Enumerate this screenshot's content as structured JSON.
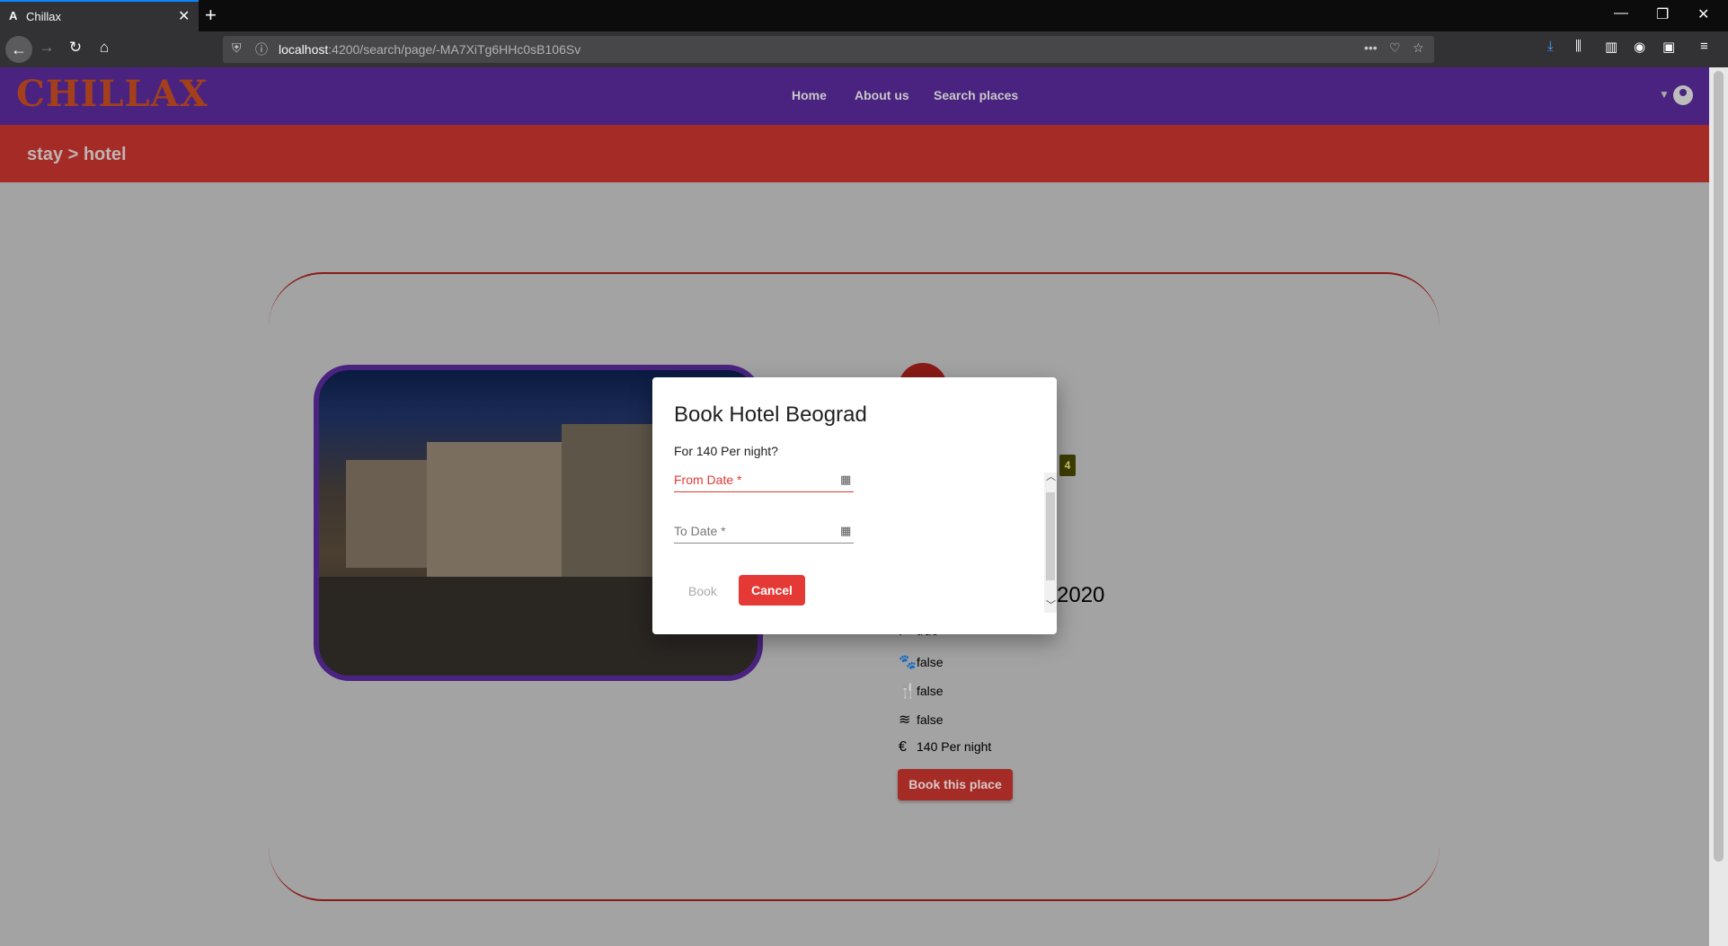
{
  "browser": {
    "tab_title": "Chillax",
    "tab_icon": "A",
    "url_host": "localhost",
    "url_rest": ":4200/search/page/-MA7XiTg6HHc0sB106Sv"
  },
  "app": {
    "logo": "CHILLAX",
    "nav": {
      "home": "Home",
      "about": "About us",
      "search": "Search places"
    },
    "breadcrumb": "stay > hotel"
  },
  "details": {
    "stars": "4",
    "date_fragment": "2020",
    "amenities": [
      {
        "icon": "parking-icon",
        "value": "true"
      },
      {
        "icon": "paw-icon",
        "value": "false"
      },
      {
        "icon": "utensils-icon",
        "value": "false"
      },
      {
        "icon": "pool-icon",
        "value": "false"
      },
      {
        "icon": "euro-icon",
        "value": "140 Per night"
      }
    ],
    "book_button": "Book this place"
  },
  "dialog": {
    "title": "Book Hotel Beograd",
    "subtitle": "For 140 Per night?",
    "from_label": "From Date *",
    "to_label": "To Date *",
    "book_label": "Book",
    "cancel_label": "Cancel"
  },
  "colors": {
    "header": "#4a2380",
    "breadcrumb_bar": "#a52c26",
    "accent": "#e53935"
  }
}
